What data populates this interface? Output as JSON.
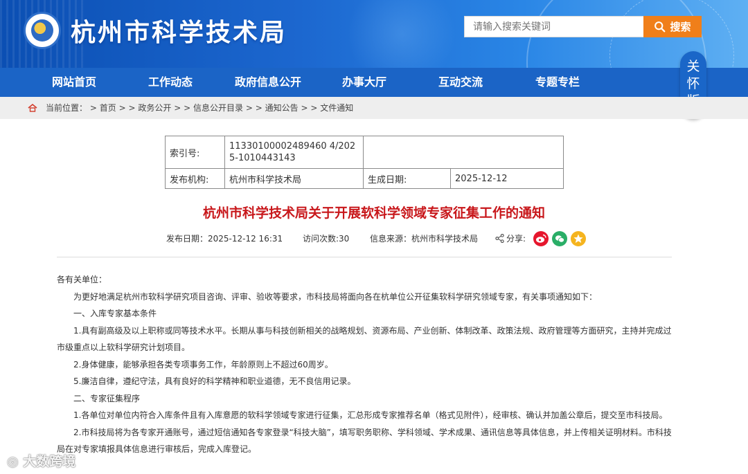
{
  "header": {
    "site_title": "杭州市科学技术局",
    "search_placeholder": "请输入搜索关键词",
    "search_button": "搜索"
  },
  "nav": {
    "items": [
      "网站首页",
      "工作动态",
      "政府信息公开",
      "办事大厅",
      "互动交流",
      "专题专栏"
    ],
    "care_mode": "关怀版"
  },
  "breadcrumb": {
    "label": "当前位置：",
    "items": [
      "首页",
      "政务公开",
      "信息公开目录",
      "通知公告",
      "文件通知"
    ],
    "separator": ">"
  },
  "meta": {
    "index_label": "索引号:",
    "index_value": "11330100002489460 4/2025-1010443143",
    "publisher_label": "发布机构:",
    "publisher_value": "杭州市科学技术局",
    "date_label": "生成日期:",
    "date_value": "2025-12-12"
  },
  "article": {
    "title": "杭州市科学技术局关于开展软科学领域专家征集工作的通知",
    "publish_date": "发布日期：2025-12-12 16:31",
    "visits": "访问次数:30",
    "source": "信息来源：杭州市科学技术局",
    "share_label": "分享:",
    "paragraphs": {
      "p0": "各有关单位：",
      "p1": "为更好地满足杭州市软科学研究项目咨询、评审、验收等要求，市科技局将面向各在杭单位公开征集软科学研究领域专家，有关事项通知如下：",
      "p2": "一、入库专家基本条件",
      "p3": "1.具有副高级及以上职称或同等技术水平。长期从事与科技创新相关的战略规划、资源布局、产业创新、体制改革、政策法规、政府管理等方面研究，主持并完成过市级重点以上软科学研究计划项目。",
      "p4": "2.身体健康，能够承担各类专项事务工作，年龄原则上不超过60周岁。",
      "p5": "5.廉洁自律，遵纪守法，具有良好的科学精神和职业道德，无不良信用记录。",
      "p6": "二、专家征集程序",
      "p7": "1.各单位对单位内符合入库条件且有入库意愿的软科学领域专家进行征集，汇总形成专家推荐名单（格式见附件），经审核、确认并加盖公章后，提交至市科技局。",
      "p8": "2.市科技局将为各专家开通账号，通过短信通知各专家登录“科技大脑”，填写职务职称、学科领域、学术成果、通讯信息等具体信息，并上传相关证明材料。市科技局在对专家填报具体信息进行审核后，完成入库登记。"
    }
  },
  "watermark": "大数跨境",
  "colors": {
    "nav_blue": "#1b64c6",
    "title_red": "#c8171b",
    "search_orange": "#f07f1a",
    "weibo": "#e6162d",
    "wechat": "#2aae67",
    "favorite": "#f5b41f"
  }
}
